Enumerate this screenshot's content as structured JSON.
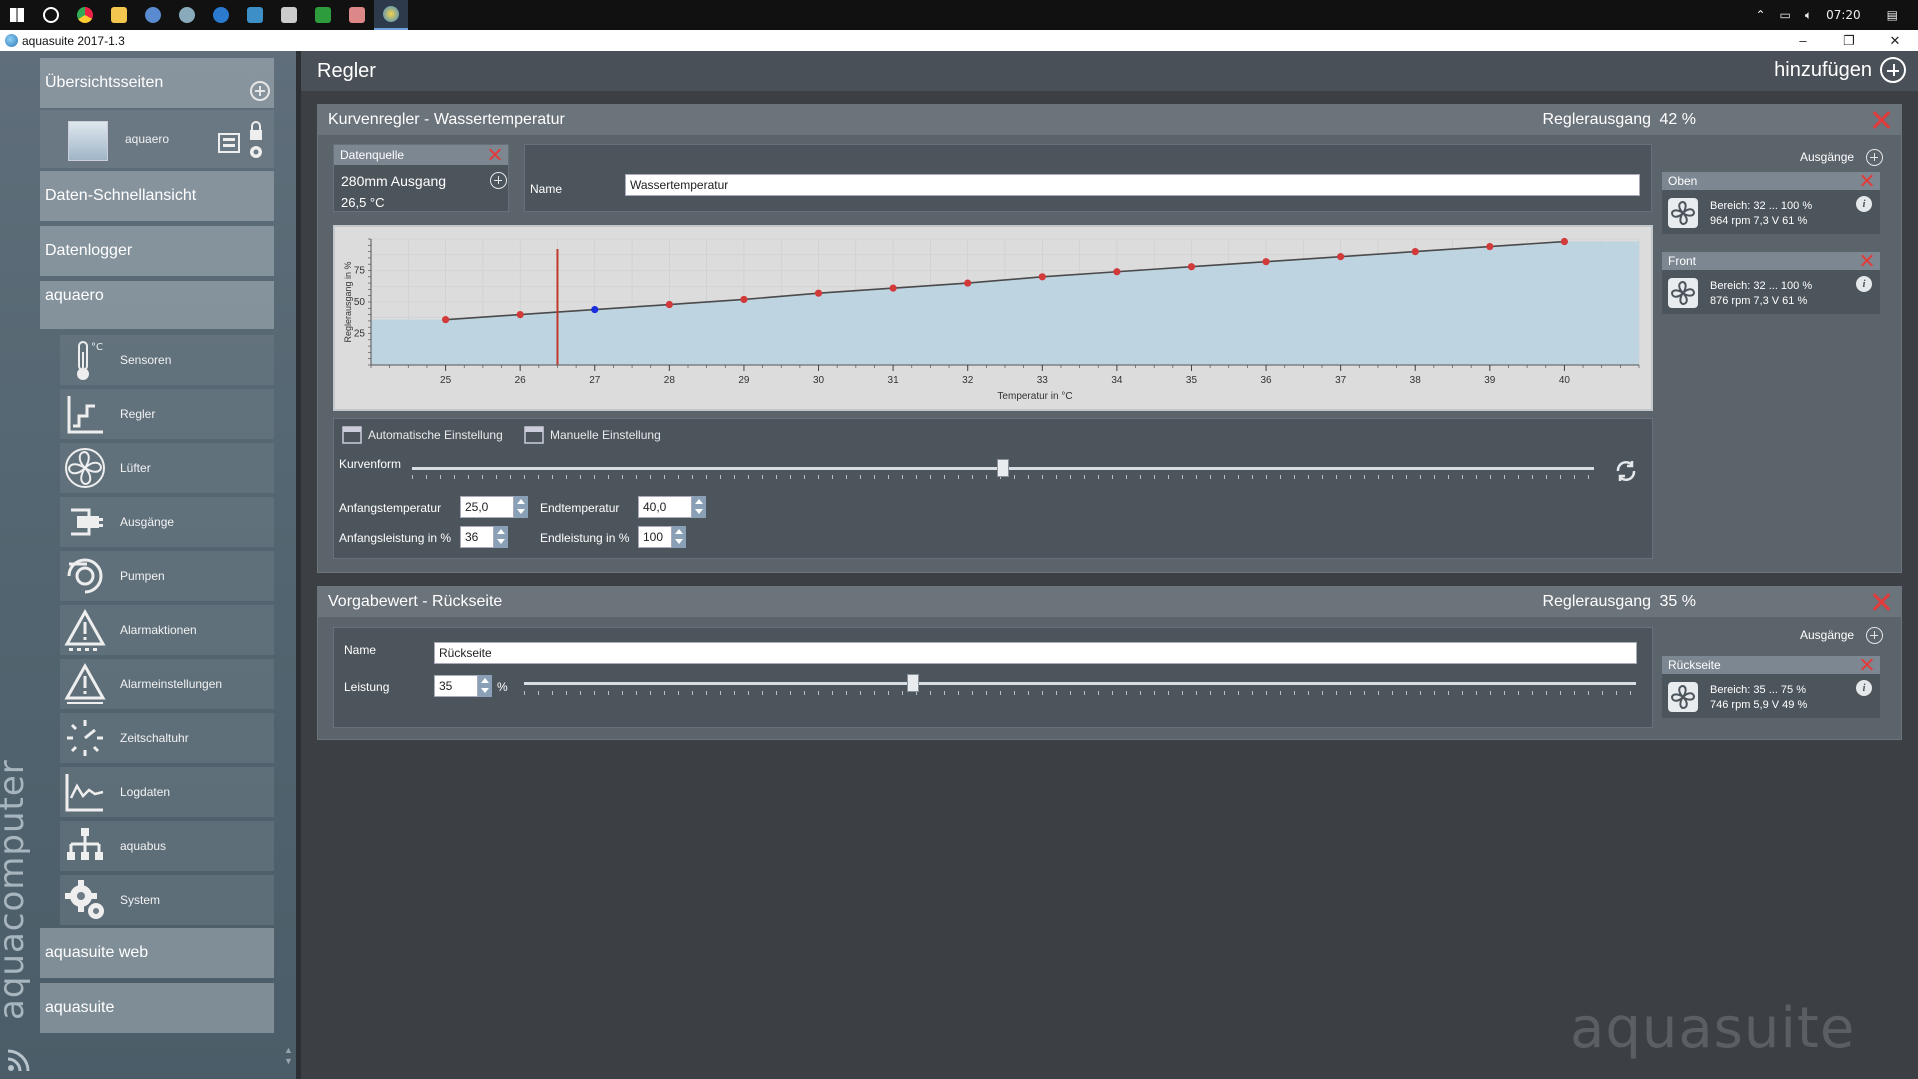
{
  "window": {
    "title": "aquasuite 2017-1.3",
    "clock": "07:20"
  },
  "sidebar": {
    "overview_label": "Übersichtsseiten",
    "overview_item": "aquaero",
    "schnell_label": "Daten-Schnellansicht",
    "logger_label": "Datenlogger",
    "aquaero_label": "aquaero",
    "items": [
      {
        "label": "Sensoren",
        "icon": "thermometer-icon"
      },
      {
        "label": "Regler",
        "icon": "controller-icon"
      },
      {
        "label": "Lüfter",
        "icon": "fan-icon"
      },
      {
        "label": "Ausgänge",
        "icon": "plug-icon"
      },
      {
        "label": "Pumpen",
        "icon": "pump-icon"
      },
      {
        "label": "Alarmaktionen",
        "icon": "alarm-icon"
      },
      {
        "label": "Alarmeinstellungen",
        "icon": "alarm-settings-icon"
      },
      {
        "label": "Zeitschaltuhr",
        "icon": "timer-icon"
      },
      {
        "label": "Logdaten",
        "icon": "logdata-icon"
      },
      {
        "label": "aquabus",
        "icon": "aquabus-icon"
      },
      {
        "label": "System",
        "icon": "gear-icon"
      }
    ],
    "web_label": "aquasuite web",
    "suite_label": "aquasuite",
    "brand_vertical": "aquacomputer"
  },
  "main": {
    "title": "Regler",
    "add_label": "hinzufügen",
    "watermark": "aquasuite"
  },
  "curve_panel": {
    "title": "Kurvenregler  -  Wassertemperatur",
    "output_label": "Reglerausgang",
    "output_value": "42 %",
    "datasource_label": "Datenquelle",
    "datasource_name": "280mm Ausgang",
    "datasource_value": "26,5 °C",
    "name_label": "Name",
    "name_value": "Wassertemperatur",
    "auto_label": "Automatische Einstellung",
    "manual_label": "Manuelle Einstellung",
    "curve_form_label": "Kurvenform",
    "curve_form_value": 0.5,
    "start_temp_label": "Anfangstemperatur",
    "start_temp_value": "25,0",
    "end_temp_label": "Endtemperatur",
    "end_temp_value": "40,0",
    "start_power_label": "Anfangsleistung in %",
    "start_power_value": "36",
    "end_power_label": "Endleistung in %",
    "end_power_value": "100",
    "outputs_label": "Ausgänge",
    "outputs": [
      {
        "name": "Oben",
        "line1": "Bereich: 32 ... 100  %",
        "line2": "964 rpm  7,3 V  61 %"
      },
      {
        "name": "Front",
        "line1": "Bereich: 32 ... 100  %",
        "line2": "876 rpm  7,3 V  61 %"
      }
    ]
  },
  "chart_data": {
    "type": "line",
    "xlabel": "Temperatur in °C",
    "ylabel": "Reglerausgang in %",
    "xlim": [
      24,
      41
    ],
    "ylim": [
      0,
      100
    ],
    "xticks": [
      25,
      26,
      27,
      28,
      29,
      30,
      31,
      32,
      33,
      34,
      35,
      36,
      37,
      38,
      39,
      40
    ],
    "yticks": [
      25,
      50,
      75
    ],
    "x": [
      25,
      26,
      27,
      28,
      29,
      30,
      31,
      32,
      33,
      34,
      35,
      36,
      37,
      38,
      39,
      40
    ],
    "y": [
      36,
      40,
      44,
      48,
      52,
      57,
      61,
      65,
      70,
      74,
      78,
      82,
      86,
      90,
      94,
      98
    ],
    "current_x": 26.5,
    "highlight_x": 27,
    "line_color": "#4a4a4a",
    "point_color": "#d23a3a",
    "highlight_color": "#1a2ee0",
    "marker_color": "#c0392b",
    "fill_color": "#b9d4e2"
  },
  "setpoint_panel": {
    "title": "Vorgabewert  -  Rückseite",
    "output_label": "Reglerausgang",
    "output_value": "35 %",
    "name_label": "Name",
    "name_value": "Rückseite",
    "power_label": "Leistung",
    "power_value": "35",
    "power_unit": "%",
    "power_fraction": 0.35,
    "outputs_label": "Ausgänge",
    "outputs": [
      {
        "name": "Rückseite",
        "line1": "Bereich: 35 ... 75  %",
        "line2": "746 rpm  5,9 V  49 %"
      }
    ]
  }
}
